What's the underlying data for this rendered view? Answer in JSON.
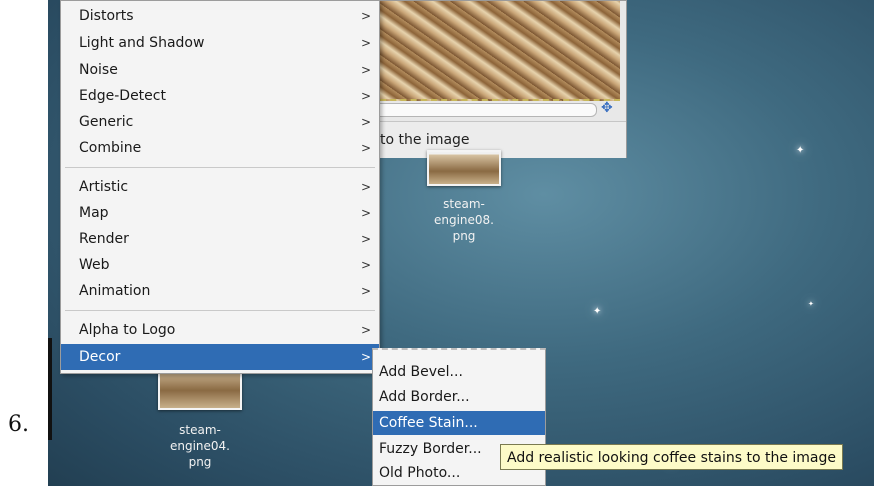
{
  "step_number": "6.",
  "image_window": {
    "status_text": "to the image"
  },
  "desktop_files": [
    {
      "name": "steam-engine08.png",
      "line1": "steam-",
      "line2": "engine08.",
      "line3": "png"
    },
    {
      "name": "steam-engine04.png",
      "line1": "steam-",
      "line2": "engine04.",
      "line3": "png"
    }
  ],
  "filters_menu": {
    "items": [
      {
        "label": "Distorts",
        "has_submenu": true
      },
      {
        "label": "Light and Shadow",
        "has_submenu": true
      },
      {
        "label": "Noise",
        "has_submenu": true
      },
      {
        "label": "Edge-Detect",
        "has_submenu": true
      },
      {
        "label": "Generic",
        "has_submenu": true
      },
      {
        "label": "Combine",
        "has_submenu": true
      },
      {
        "label": "Artistic",
        "has_submenu": true
      },
      {
        "label": "Map",
        "has_submenu": true
      },
      {
        "label": "Render",
        "has_submenu": true
      },
      {
        "label": "Web",
        "has_submenu": true
      },
      {
        "label": "Animation",
        "has_submenu": true
      },
      {
        "label": "Alpha to Logo",
        "has_submenu": true
      },
      {
        "label": "Decor",
        "has_submenu": true,
        "selected": true
      }
    ],
    "arrow": ">"
  },
  "decor_submenu": {
    "items": [
      {
        "label": "Add Bevel..."
      },
      {
        "label": "Add Border..."
      },
      {
        "label": "Coffee Stain...",
        "selected": true
      },
      {
        "label": "Fuzzy Border..."
      },
      {
        "label": "Old Photo..."
      }
    ]
  },
  "tooltip": {
    "text": "Add realistic looking coffee stains to the image"
  },
  "colors": {
    "selection": "#2f6cb4",
    "tooltip_bg": "#fdfbc8",
    "desktop": "#3f6a80"
  }
}
